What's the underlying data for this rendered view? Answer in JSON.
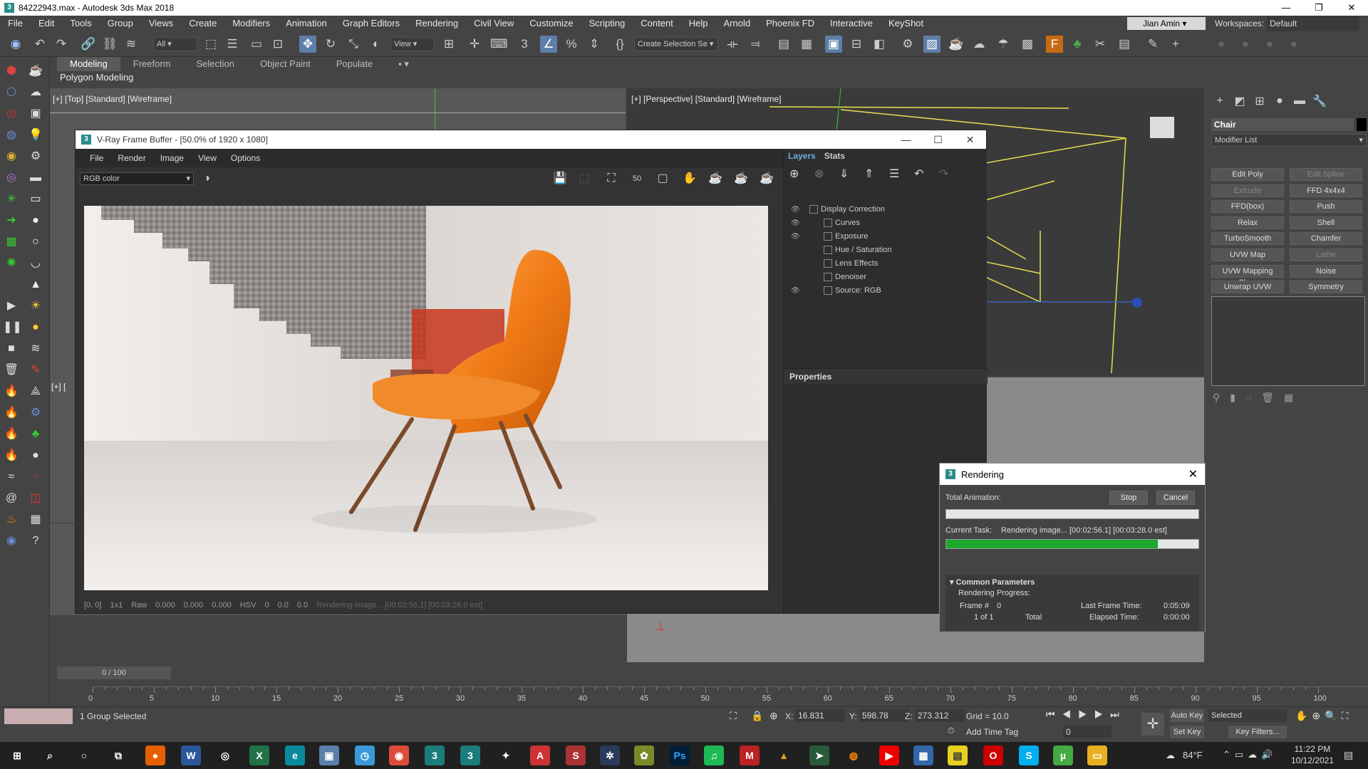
{
  "titlebar": {
    "title": "84222943.max - Autodesk 3ds Max 2018",
    "app_glyph": "3"
  },
  "menubar": {
    "items": [
      "File",
      "Edit",
      "Tools",
      "Group",
      "Views",
      "Create",
      "Modifiers",
      "Animation",
      "Graph Editors",
      "Rendering",
      "Civil View",
      "Customize",
      "Scripting",
      "Content",
      "Help",
      "Arnold",
      "Phoenix FD",
      "Interactive",
      "KeyShot"
    ],
    "user": "Jian Amin",
    "workspaces_label": "Workspaces:",
    "workspace_value": "Default"
  },
  "toolbar": {
    "filter_value": "All",
    "refcoord_value": "View",
    "selection_set_value": "Create Selection Se"
  },
  "ribbon": {
    "tabs": [
      "Modeling",
      "Freeform",
      "Selection",
      "Object Paint",
      "Populate"
    ],
    "active_tab": "Modeling",
    "panel_label": "Polygon Modeling"
  },
  "viewports": {
    "top_label": "[+] [Top] [Standard] [Wireframe]",
    "persp_label": "[+] [Perspective] [Standard] [Wireframe]",
    "left_label": "[+] ["
  },
  "command_panel": {
    "object_name": "Chair",
    "modifier_list": "Modifier List",
    "buttons": [
      {
        "label": "Edit Poly",
        "disabled": false
      },
      {
        "label": "Edit Spline",
        "disabled": true
      },
      {
        "label": "Extrude",
        "disabled": true
      },
      {
        "label": "FFD 4x4x4",
        "disabled": false
      },
      {
        "label": "FFD(box)",
        "disabled": false
      },
      {
        "label": "Push",
        "disabled": false
      },
      {
        "label": "Relax",
        "disabled": false
      },
      {
        "label": "Shell",
        "disabled": false
      },
      {
        "label": "TurboSmooth",
        "disabled": false
      },
      {
        "label": "Chamfer",
        "disabled": false
      },
      {
        "label": "UVW Map",
        "disabled": false
      },
      {
        "label": "Lathe",
        "disabled": true
      },
      {
        "label": "UVW Mapping Clear",
        "disabled": false
      },
      {
        "label": "Noise",
        "disabled": false
      },
      {
        "label": "Unwrap UVW",
        "disabled": false
      },
      {
        "label": "Symmetry",
        "disabled": false
      }
    ]
  },
  "vfb": {
    "title": "V-Ray Frame Buffer - [50.0% of 1920 x 1080]",
    "menu": [
      "File",
      "Render",
      "Image",
      "View",
      "Options"
    ],
    "channel": "RGB color",
    "zoom_btn": "50",
    "layers_tab": "Layers",
    "stats_tab": "Stats",
    "layers": [
      {
        "name": "Display Correction",
        "visible": true,
        "indent": 0
      },
      {
        "name": "Curves",
        "visible": true,
        "indent": 1
      },
      {
        "name": "Exposure",
        "visible": true,
        "indent": 1
      },
      {
        "name": "Hue / Saturation",
        "visible": false,
        "indent": 1
      },
      {
        "name": "Lens Effects",
        "visible": false,
        "indent": 1
      },
      {
        "name": "Denoiser",
        "visible": false,
        "indent": 1
      },
      {
        "name": "Source: RGB",
        "visible": true,
        "indent": 1
      }
    ],
    "properties_label": "Properties",
    "status": {
      "coords": "[0, 0]",
      "sample": "1x1",
      "raw": "Raw",
      "r": "0.000",
      "g": "0.000",
      "b": "0.000",
      "mode": "HSV",
      "h": "0",
      "s": "0.0",
      "v": "0.0",
      "msg": "Rendering image... [00:02:56.1] [00:03:28.0 est]"
    }
  },
  "render_dialog": {
    "title": "Rendering",
    "stop": "Stop",
    "cancel": "Cancel",
    "total_animation_label": "Total Animation:",
    "total_progress": 0,
    "current_task_label": "Current Task:",
    "current_task_value": "Rendering image... [00:02:56.1] [00:03:28.0 est]",
    "current_progress": 0.84,
    "common_params": "Common Parameters",
    "rendering_progress": "Rendering Progress:",
    "frame_label": "Frame #",
    "frame_value": "0",
    "of_label": "1 of 1",
    "total_label": "Total",
    "last_frame_label": "Last Frame Time:",
    "last_frame_value": "0:05:09",
    "elapsed_label": "Elapsed Time:",
    "elapsed_value": "0:00:00"
  },
  "timeline": {
    "slider": "0 / 100",
    "ticks": [
      "0",
      "5",
      "10",
      "15",
      "20",
      "25",
      "30",
      "35",
      "40",
      "45",
      "50",
      "55",
      "60",
      "65",
      "70",
      "75",
      "80",
      "85",
      "90",
      "95",
      "100"
    ]
  },
  "statusbar": {
    "selection": "1 Group Selected",
    "x_label": "X:",
    "x": "16.831",
    "y_label": "Y:",
    "y": "598.78",
    "z_label": "Z:",
    "z": "273.312",
    "grid": "Grid = 10.0",
    "add_time_tag": "Add Time Tag",
    "auto_key": "Auto Key",
    "set_key": "Set Key",
    "selected": "Selected",
    "key_filters": "Key Filters...",
    "frame": "0"
  },
  "taskbar": {
    "temp": "84°F",
    "time": "11:22 PM",
    "date": "10/12/2021"
  }
}
